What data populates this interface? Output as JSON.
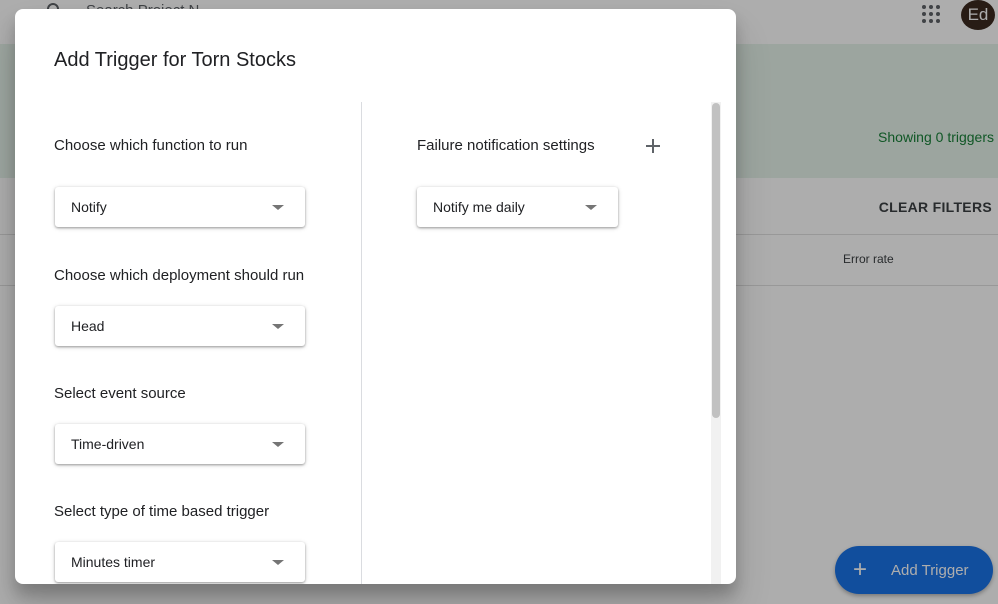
{
  "background": {
    "search_placeholder": "Search Project N...",
    "avatar_initials": "Ed",
    "showing_text": "Showing 0 triggers",
    "clear_filters_label": "CLEAR FILTERS",
    "column_error_rate": "Error rate",
    "add_trigger_label": "Add Trigger"
  },
  "dialog": {
    "title": "Add Trigger for Torn Stocks",
    "function": {
      "label": "Choose which function to run",
      "value": "Notify"
    },
    "deployment": {
      "label": "Choose which deployment should run",
      "value": "Head"
    },
    "event_source": {
      "label": "Select event source",
      "value": "Time-driven"
    },
    "time_trigger_type": {
      "label": "Select type of time based trigger",
      "value": "Minutes timer"
    },
    "failure": {
      "label": "Failure notification settings",
      "value": "Notify me daily"
    }
  },
  "colors": {
    "accent": "#1a73e8",
    "banner": "#e6f4ea",
    "success_text": "#188038",
    "avatar": "#3c2a1f"
  }
}
